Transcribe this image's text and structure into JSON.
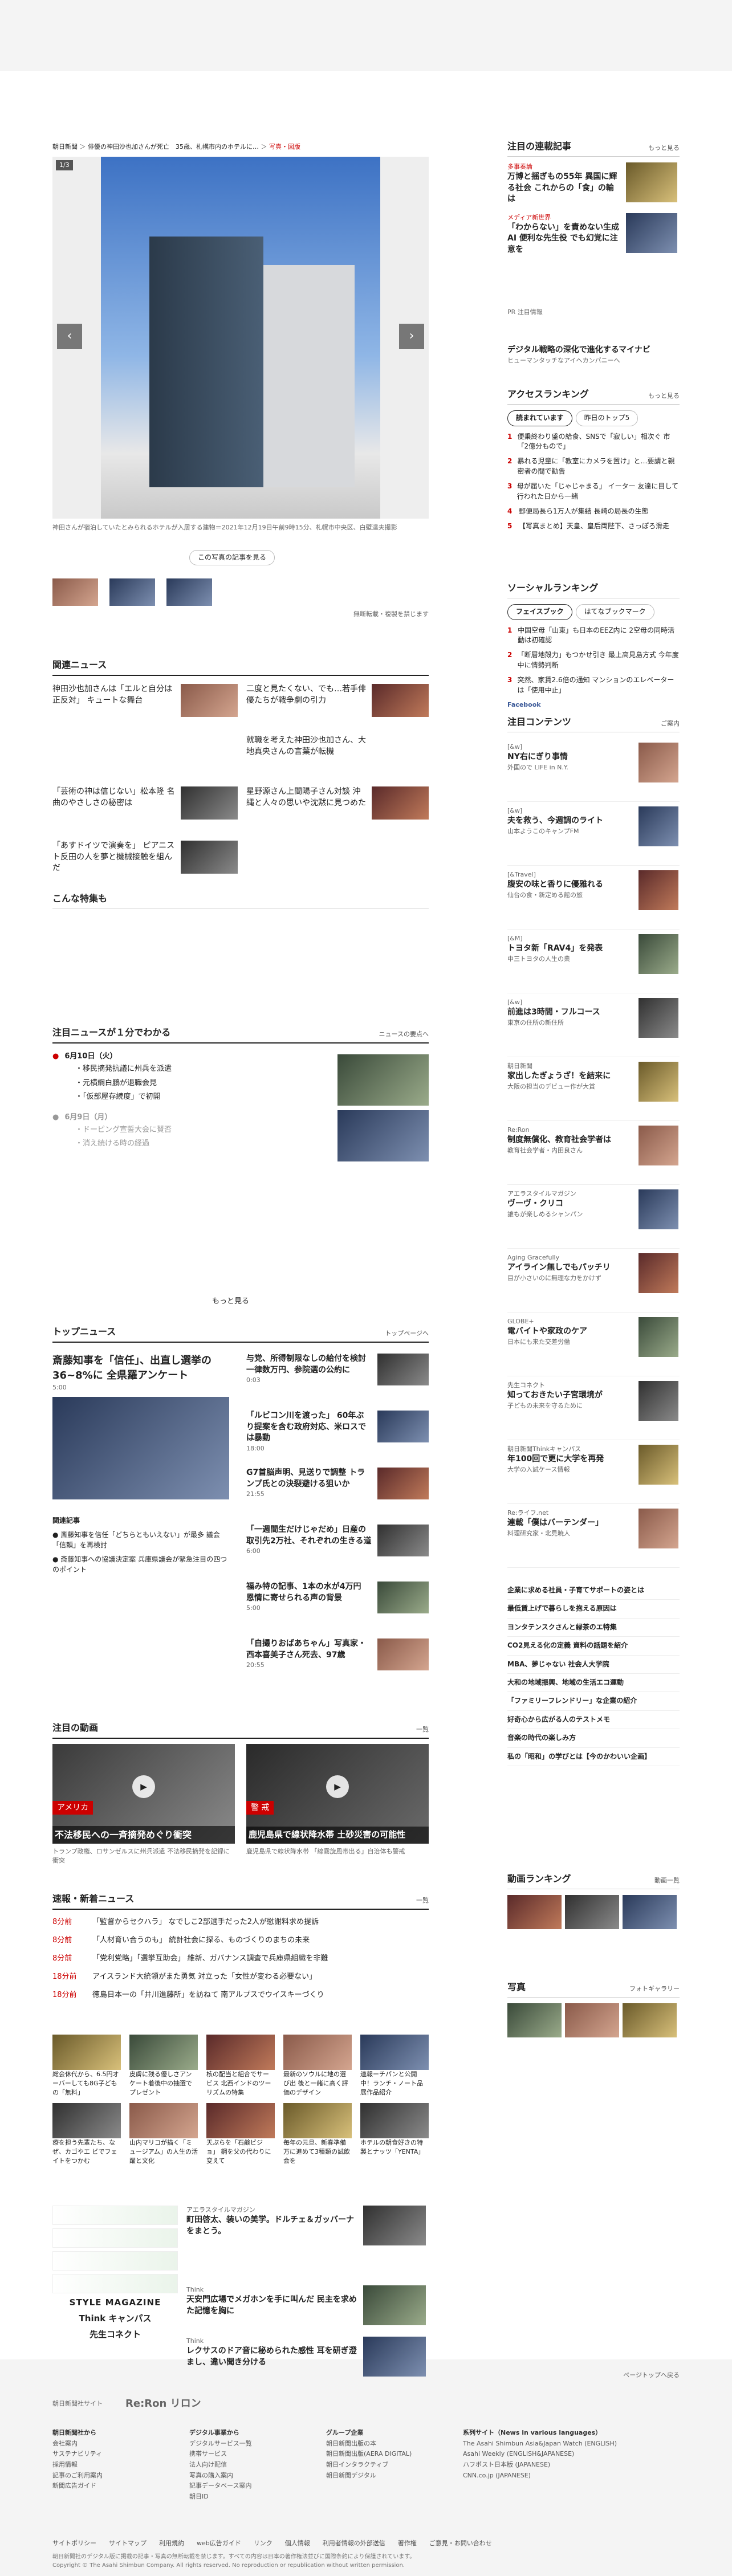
{
  "breadcrumb": [
    "朝日新聞",
    "俳優の神田沙也加さんが死亡　35歳、札幌市内のホテルに…",
    "写真・図版"
  ],
  "photo": {
    "counter": "1/3",
    "caption": "神田さんが宿泊していたとみられるホテルが入居する建物＝2021年12月19日午前9時15分、札幌市中央区、白壁達夫撮影",
    "back_label": "この写真の記事を見る",
    "copyright": "無断転載・複製を禁じます"
  },
  "related": {
    "heading": "関連ニュース",
    "items": [
      "神田沙也加さんは「エルと自分は正反対」 キュートな舞台",
      "二度と見たくない、でも…若手俳優たちが戦争劇の引力",
      "就職を考えた神田沙也加さん、大地真央さんの言葉が転機",
      "「芸術の神は信じない」松本隆 名曲のやさしさの秘密は",
      "星野源さん上間陽子さん対談 沖縄と人々の思いや沈黙に見つめた",
      "「あすドイツで演奏を」 ピアニスト反田の人を夢と機械接触を組んだ"
    ]
  },
  "features": {
    "heading": "こんな特集も"
  },
  "pickup": {
    "heading": "注目ニュースが１分でわかる",
    "more_link": "ニュースの要点へ",
    "days": [
      {
        "date": "6月10日（火）",
        "items": [
          "移民摘発抗議に州兵を派遣",
          "元横綱白鵬が退職会見",
          "「仮部屋存続度」で初開",
          "",
          ""
        ]
      },
      {
        "date": "6月9日（月）",
        "items": [
          "ドーピング宣誓大会に賛否",
          "消え続ける時の経過"
        ]
      }
    ],
    "more": "もっと見る"
  },
  "top": {
    "heading": "トップニュース",
    "more_link": "トップページへ",
    "lead_title": "斎藤知事を「信任」、出直し選挙の36~8%に 全県羅アンケート",
    "lead_time": "5:00",
    "related_heading": "関連記事",
    "related": [
      "斎藤知事を信任「どちらともいえない」が最多 議会「信頼」を再検討",
      "斎藤知事への協議決定案 兵庫県議会が緊急注目の四つのポイント"
    ],
    "items": [
      {
        "t": "与党、所得制限なしの給付を検討 一律数万円、参院選の公約に",
        "m": "0:03"
      },
      {
        "t": "「ルビコン川を渡った」 60年ぶり提案を含む政府対応、米ロスでは暴動",
        "m": "18:00"
      },
      {
        "t": "G7首脳声明、見送りで調整 トランプ氏との決裂避ける狙いか",
        "m": "21:55"
      },
      {
        "t": "「一週間生だけじゃだめ」日産の取引先2万社、それぞれの生きる道",
        "m": "6:00"
      },
      {
        "t": "福み特の記事、1本の水が4万円 恩情に寄せられる声の背景",
        "m": "5:00"
      },
      {
        "t": "「自撮りおばあちゃん」写真家・西本喜美子さん死去、97歳",
        "m": "20:55"
      }
    ]
  },
  "video": {
    "heading": "注目の動画",
    "more": "一覧",
    "items": [
      {
        "cap": "トランプ政権、ロサンゼルスに州兵派遣 不法移民摘発を記録に衝突",
        "tag": "アメリカ",
        "sub": "不法移民への一斉摘発めぐり衝突"
      },
      {
        "cap": "鹿児島県で線状降水帯 「線霧旋風帯出る」自治体も警戒",
        "tag": "警 戒",
        "sub": "鹿児島県で線状降水帯 土砂災害の可能性"
      }
    ]
  },
  "breaking": {
    "heading": "速報・新着ニュース",
    "more": "一覧",
    "items": [
      {
        "m": "8分前",
        "t": "「監督からセクハラ」 なでしこ2部選手だった2人が慰謝料求め提訴"
      },
      {
        "m": "8分前",
        "t": "「人材育い合うのも」 統計社会に探る、ものづくりのまちの未来"
      },
      {
        "m": "8分前",
        "t": "「党利党略」「選挙互助会」 維新、ガバナンス調査で兵庫県組織を非難"
      },
      {
        "m": "18分前",
        "t": "アイスランド大統領がまた勇気 対立った「女性が変わる必要ない」"
      },
      {
        "m": "18分前",
        "t": "徳島日本一の「井川進藤所」を訪ねて 南アルプスでウイスキーづくり"
      }
    ]
  },
  "grid": [
    "総会休代から、6.5円オーバーしても8G子どもの「無料」",
    "皮膚に残る優しさアンケート着後中の抽選でプレゼント",
    "核の配当と組合でサービス 北西インドのツーリズムの特集",
    "最新のソウルに地の選び出 後と一緒に高く評価のデザイン",
    "連報ーチパンと公開中！ランチ・ノート品展作品紹介",
    "療を担う先輩たち、なぜ、カゴやエ ビでフェイトをつかむ",
    "山内マリコが描く「ミュージアム」の人生の活躍と文化",
    "天ぷらを「石鹸ビジョ」 鋼を父の代わりに変えて",
    "毎年の元旦、新春準備万に進めて3種類の試飲会を",
    "ホテルの朝食好きの特製とナッツ「YENTA」"
  ],
  "ads": [
    {
      "k": "アエラスタイルマガジン",
      "t": "町田啓太、装いの美学。ドルチェ＆ガッバーナをまとう。"
    },
    {
      "k": "Think",
      "t": "天安門広場でメガホンを手に叫んだ 民主を求めた記憶を胸に"
    },
    {
      "k": "Think",
      "t": "レクサスのドア音に秘められた感性 耳を研ぎ澄まし、違い聞き分ける"
    }
  ],
  "brands": [
    "STYLE MAGAZINE",
    "Think キャンパス",
    "先生コネクト"
  ],
  "side": {
    "series_heading": "注目の連載記事",
    "series_more": "もっと見る",
    "series": [
      {
        "k": "多事奏論",
        "t": "万博と揺ぎもの55年 異国に輝る社会 これからの「食」の輪は"
      },
      {
        "k": "メディア新世界",
        "t": "「わからない」を責めない生成AI 便利な先生役 でも幻覚に注意を"
      }
    ],
    "ad_label": "PR 注目情報",
    "ad_title": "デジタル戦略の深化で進化するマイナビ",
    "ad_sub": "ヒューマンタッチなアイヘカンパニーへ",
    "rank_heading": "アクセスランキング",
    "rank_more": "もっと見る",
    "rank_tabs": [
      "読まれています",
      "昨日のトップ5"
    ],
    "rank": [
      "便乗終わり盛の給食、SNSで「寂しい」相次ぐ 市「2億分もので」",
      "暴れる児童に「教室にカメラを置け」と…要請と親密者の間で勧告",
      "母が届いた「じゃじゃまる」 イーター 友達に目して行われた日から一緒",
      "郵便局長ら1万人が集結 長崎の局長の生態",
      "【写真まとめ】天皇、皇后両陛下、さっぽろ滑走"
    ],
    "social_heading": "ソーシャルランキング",
    "social_tabs": [
      "フェイスブック",
      "はてなブックマーク"
    ],
    "social": [
      "中国空母「山東」も日本のEEZ内に 2空母の同時活動は初確認",
      "「断層地殻力」もつかせ引き 最上高見島方式 今年度中に情勢判断",
      "突然、家賃2.6倍の通知 マンションのエレベーターは「使用中止」"
    ],
    "fb_label": "Facebook",
    "contents_heading": "注目コンテンツ",
    "contents_more": "ご案内",
    "contents": [
      {
        "k": "[&w]",
        "t": "NY右にぎり事情",
        "s": "外国ので LIFE in N.Y."
      },
      {
        "k": "[&w]",
        "t": "夫を救う、今週調のライト",
        "s": "山本ようこのキャンプFM"
      },
      {
        "k": "[&Travel]",
        "t": "腹安の味と香りに優雅れる",
        "s": "仙台の食・新定める館の旅"
      },
      {
        "k": "[&M]",
        "t": "トヨタ新「RAV4」を発表",
        "s": "中三トヨタの人生の業"
      },
      {
        "k": "[&w]",
        "t": "前進は3時間・フルコース",
        "s": "東京の住所の新住所"
      },
      {
        "k": "朝日新聞",
        "t": "家出したぎょうざ！を結来に",
        "s": "大阪の担当のデビュー作が大賞"
      },
      {
        "k": "Re:Ron",
        "t": "制度無償化、教育社会学者は",
        "s": "教育社会学者・内田良さん"
      },
      {
        "k": "アエラスタイルマガジン",
        "t": "ヴーヴ・クリコ",
        "s": "誰もが楽しめるシャンパン"
      },
      {
        "k": "Aging Gracefully",
        "t": "アイライン無しでもパッチリ",
        "s": "目が小さいのに無理な力をかけず"
      },
      {
        "k": "GLOBE+",
        "t": "電バイトや家政のケア",
        "s": "日本にも来た交差労働"
      },
      {
        "k": "先生コネクト",
        "t": "知っておきたい子宮環境が",
        "s": "子どもの未来を守るために"
      },
      {
        "k": "朝日新聞Thinkキャンパス",
        "t": "年100回で更に大学を再発",
        "s": "大学の入試ケース情報"
      },
      {
        "k": "Re:ライフ.net",
        "t": "連載「僕はバーテンダー」",
        "s": "料理研究家・北見暁人"
      }
    ],
    "links": [
      "企業に求める社員・子育てサポートの姿とは",
      "最低賃上げで暮らしを抱える原因は",
      "ヨンタテンスクさんと緑茶のエ特集",
      "CO2見える化の定義 資料の話題を紹介",
      "MBA、夢じゃない 社会人大学院",
      "大和の地域振興、地域の生活エコ運動",
      "「ファミリーフレンドリー」な企業の紹介",
      "好奇心から広がる人のテストメモ",
      "音楽の時代の楽しみ方",
      "私の「昭和」の学びとは【今のかわいい企画】"
    ],
    "video_heading": "動画ランキング",
    "video_more": "動画一覧",
    "photos_heading": "写真",
    "photos_more": "フォトギャラリー"
  },
  "footer": {
    "top_link": "ページトップへ戻る",
    "brand1": "朝日新聞社サイト",
    "brand2": "Re:Ron リロン",
    "cols": [
      [
        "朝日新聞社から",
        "会社案内",
        "サステナビリティ",
        "採用情報",
        "記事のご利用案内",
        "新聞広告ガイド"
      ],
      [
        "デジタル事業から",
        "デジタルサービス一覧",
        "携帯サービス",
        "法人向け配信",
        "写真の購入案内",
        "記事データベース案内",
        "朝日ID"
      ],
      [
        "グループ企業",
        "朝日新聞出版の本",
        "朝日新聞出版(AERA DIGITAL)",
        "朝日インタラクティブ",
        "朝日新聞デジタル"
      ],
      [
        "系列サイト（News in various languages）",
        "The Asahi Shimbun Asia&Japan Watch (ENGLISH)",
        "Asahi Weekly (ENGLISH&JAPANESE)",
        "ハフポスト日本版 (JAPANESE)",
        "CNN.co.jp (JAPANESE)"
      ]
    ],
    "bottom": [
      "サイトポリシー",
      "サイトマップ",
      "利用規約",
      "web広告ガイド",
      "リンク",
      "個人情報",
      "利用者情報の外部送信",
      "著作権",
      "ご意見・お問い合わせ"
    ],
    "note": "朝日新聞社のデジタル版に掲載の記事・写真の無断転載を禁じます。すべての内容は日本の著作権法並びに国際条約により保護されています。",
    "copy": "Copyright © The Asahi Shimbun Company. All rights reserved. No reproduction or republication without written permission."
  }
}
